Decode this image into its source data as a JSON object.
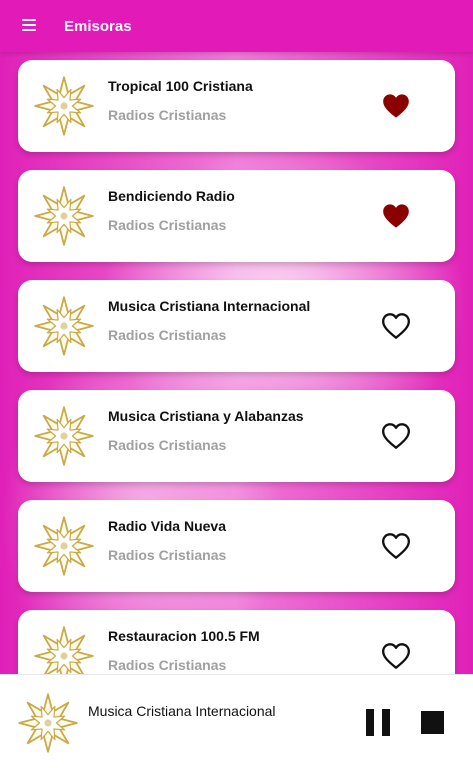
{
  "app_bar": {
    "title": "Emisoras",
    "background": "#e21ab8",
    "menu_icon": "hamburger-menu-icon"
  },
  "stations": [
    {
      "name": "Tropical 100 Cristiana",
      "category": "Radios Cristianas",
      "favorite": true
    },
    {
      "name": "Bendiciendo Radio",
      "category": "Radios Cristianas",
      "favorite": true
    },
    {
      "name": "Musica Cristiana Internacional",
      "category": "Radios Cristianas",
      "favorite": false
    },
    {
      "name": "Musica Cristiana y Alabanzas",
      "category": "Radios Cristianas",
      "favorite": false
    },
    {
      "name": "Radio Vida Nueva",
      "category": "Radios Cristianas",
      "favorite": false
    },
    {
      "name": "Restauracion 100.5 FM",
      "category": "Radios Cristianas",
      "favorite": false
    }
  ],
  "icons": {
    "station_logo": "gold-star-logo-icon",
    "favorite_on": "heart-filled-icon",
    "favorite_off": "heart-outline-icon",
    "pause": "pause-icon",
    "stop": "stop-icon"
  },
  "colors": {
    "accent": "#e21ab8",
    "favorite": "#8b0000",
    "subtitle": "#a0a0a0",
    "star_gold": "#c9a94a"
  },
  "player": {
    "now_playing": "Musica Cristiana Internacional"
  }
}
